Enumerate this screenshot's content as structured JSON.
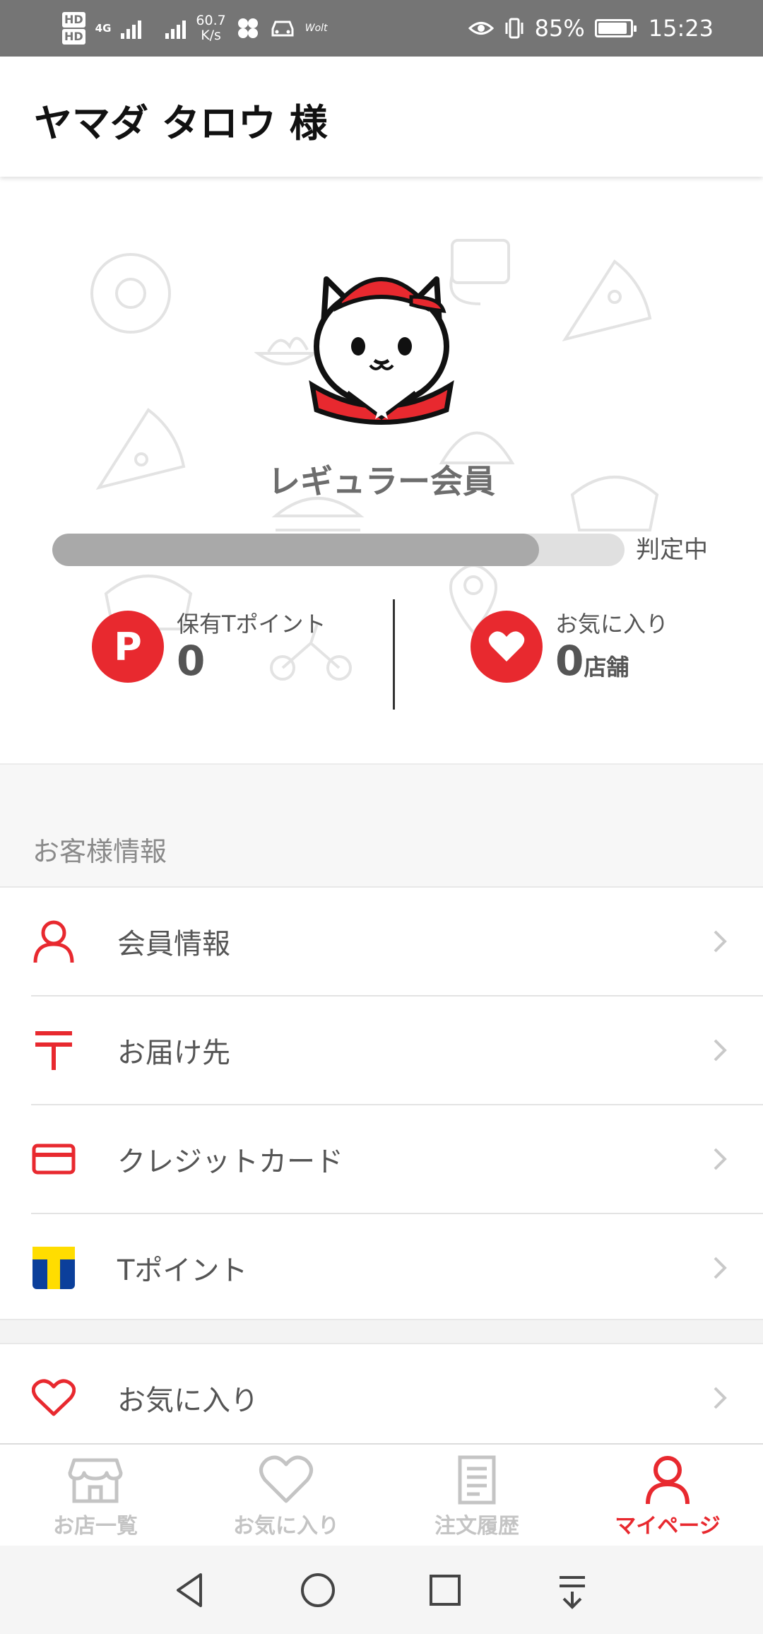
{
  "status_bar": {
    "hd1": "HD",
    "hd2": "HD",
    "network_type": "4G",
    "net_speed_value": "60.7",
    "net_speed_unit": "K/s",
    "app_tag": "Wolt",
    "battery_percent": "85%",
    "time": "15:23"
  },
  "header": {
    "title": "ヤマダ タロウ 様"
  },
  "profile": {
    "rank": "レギュラー会員",
    "progress": 0.85,
    "progress_status": "判定中",
    "points": {
      "icon_letter": "P",
      "label": "保有Tポイント",
      "value": "0"
    },
    "favorites": {
      "label": "お気に入り",
      "value": "0",
      "unit": "店舗"
    }
  },
  "customer_section": {
    "title": "お客様情報",
    "items": [
      {
        "label": "会員情報",
        "icon": "person-icon"
      },
      {
        "label": "お届け先",
        "icon": "postal-mark-icon"
      },
      {
        "label": "クレジットカード",
        "icon": "credit-card-icon"
      },
      {
        "label": "Tポイント",
        "icon": "t-point-icon"
      }
    ]
  },
  "other_menu": {
    "items": [
      {
        "label": "お気に入り",
        "icon": "heart-icon"
      }
    ]
  },
  "bottom_nav": {
    "items": [
      {
        "label": "お店一覧",
        "icon": "store-icon"
      },
      {
        "label": "お気に入り",
        "icon": "heart-icon"
      },
      {
        "label": "注文履歴",
        "icon": "document-icon"
      },
      {
        "label": "マイページ",
        "icon": "person-icon",
        "active": true
      }
    ]
  },
  "colors": {
    "accent_red": "#e8292f",
    "inactive_gray": "#c4c4c4",
    "tpoint_yellow": "#ffdd00",
    "tpoint_blue": "#0b3f9b"
  }
}
